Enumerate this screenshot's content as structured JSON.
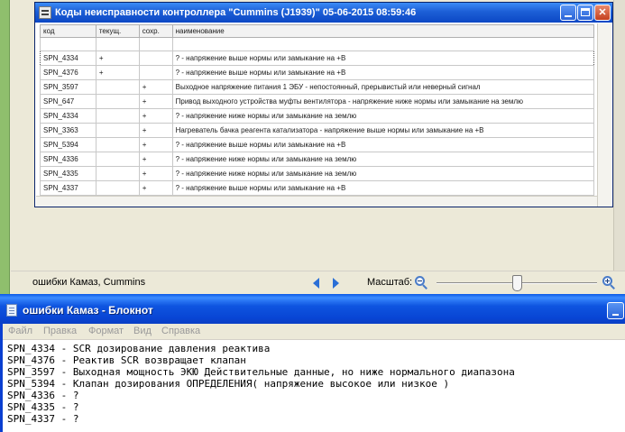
{
  "dialog": {
    "title": "Коды неисправности контроллера \"Cummins (J1939)\"   05-06-2015 08:59:46",
    "columns": [
      "код",
      "текущ.",
      "сохр.",
      "наименование"
    ],
    "rows": [
      {
        "code": "SPN_4334",
        "current": "+",
        "saved": "",
        "name": "? - напряжение выше нормы или замыкание на +В"
      },
      {
        "code": "SPN_4376",
        "current": "+",
        "saved": "",
        "name": "? - напряжение выше нормы или замыкание на +В"
      },
      {
        "code": "SPN_3597",
        "current": "",
        "saved": "+",
        "name": "Выходное напряжение питания 1 ЭБУ - непостоянный, прерывистый или неверный сигнал"
      },
      {
        "code": "SPN_647",
        "current": "",
        "saved": "+",
        "name": "Привод выходного устройства муфты вентилятора - напряжение ниже нормы или замыкание на землю"
      },
      {
        "code": "SPN_4334",
        "current": "",
        "saved": "+",
        "name": "? - напряжение ниже нормы или замыкание на землю"
      },
      {
        "code": "SPN_3363",
        "current": "",
        "saved": "+",
        "name": "Нагреватель бачка реагента катализатора - напряжение выше нормы или замыкание на +В"
      },
      {
        "code": "SPN_5394",
        "current": "",
        "saved": "+",
        "name": "? - напряжение выше нормы или замыкание на +В"
      },
      {
        "code": "SPN_4336",
        "current": "",
        "saved": "+",
        "name": "? - напряжение ниже нормы или замыкание на землю"
      },
      {
        "code": "SPN_4335",
        "current": "",
        "saved": "+",
        "name": "? - напряжение ниже нормы или замыкание на землю"
      },
      {
        "code": "SPN_4337",
        "current": "",
        "saved": "+",
        "name": "? - напряжение выше нормы или замыкание на +В"
      }
    ]
  },
  "viewer": {
    "file_name": "ошибки Камаз, Cummins",
    "zoom_label": "Масштаб:",
    "zoom_level": 0.5
  },
  "notepad": {
    "title": "ошибки Камаз - Блокнот",
    "menu": [
      "Файл",
      "Правка",
      "Формат",
      "Вид",
      "Справка"
    ],
    "lines": [
      "SPN_4334 - SCR дозирование давления реактива",
      "SPN_4376 - Реактив SCR возвращает клапан",
      "SPN_3597 - Выходная мощность ЭКЮ Действительные данные, но ниже нормального диапазона",
      "SPN_5394 - Клапан дозирования ОПРЕДЕЛЕНИЯ( напряжение высокое или низкое )",
      "SPN_4336 - ?",
      "SPN_4335 - ?",
      "SPN_4337 - ?"
    ]
  },
  "colors": {
    "titlebar_blue": "#0845d4",
    "window_face": "#ece9d8",
    "taskbar_green": "#8fbf6d"
  },
  "icons": [
    "window-menu-icon",
    "minimize-icon",
    "maximize-icon",
    "close-icon",
    "prev-arrow-icon",
    "next-arrow-icon",
    "zoom-out-icon",
    "zoom-in-icon",
    "notepad-icon"
  ]
}
